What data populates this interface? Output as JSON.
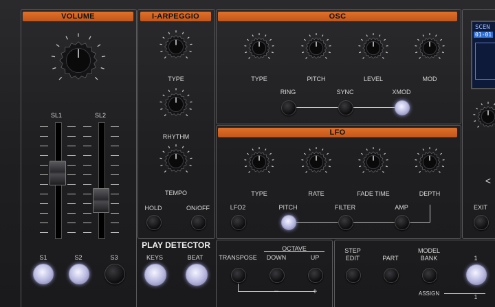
{
  "volume": {
    "header": "VOLUME",
    "sliders": [
      "SL1",
      "SL2"
    ],
    "buttons": [
      "S1",
      "S2",
      "S3"
    ]
  },
  "arpeggio": {
    "header": "I-ARPEGGIO",
    "knobs": [
      "TYPE",
      "RHYTHM",
      "TEMPO"
    ],
    "buttons": [
      "HOLD",
      "ON/OFF"
    ]
  },
  "play_detector": {
    "title": "PLAY DETECTOR",
    "buttons": [
      "KEYS",
      "BEAT"
    ]
  },
  "osc": {
    "header": "OSC",
    "knobs": [
      "TYPE",
      "PITCH",
      "LEVEL",
      "MOD"
    ],
    "buttons": [
      "RING",
      "SYNC",
      "XMOD"
    ]
  },
  "lfo": {
    "header": "LFO",
    "knobs": [
      "TYPE",
      "RATE",
      "FADE TIME",
      "DEPTH"
    ],
    "buttons": [
      "LFO2",
      "PITCH",
      "FILTER",
      "AMP"
    ]
  },
  "bottom": {
    "octave": "OCTAVE",
    "transpose": "TRANSPOSE",
    "down": "DOWN",
    "up": "UP",
    "minus": "–",
    "plus": "+",
    "step_edit": [
      "STEP",
      "EDIT"
    ],
    "part": "PART",
    "model_bank": [
      "MODEL",
      "BANK"
    ],
    "assign": "ASSIGN",
    "number": "1",
    "sub_number": "1"
  },
  "right": {
    "scene": "SCEN",
    "scene_value": "01-01",
    "exit": "EXIT",
    "arrow": "<"
  },
  "colors": {
    "header_orange": "#d5631f",
    "lit_button": "#c8c8f0",
    "panel": "#1f1f21"
  }
}
